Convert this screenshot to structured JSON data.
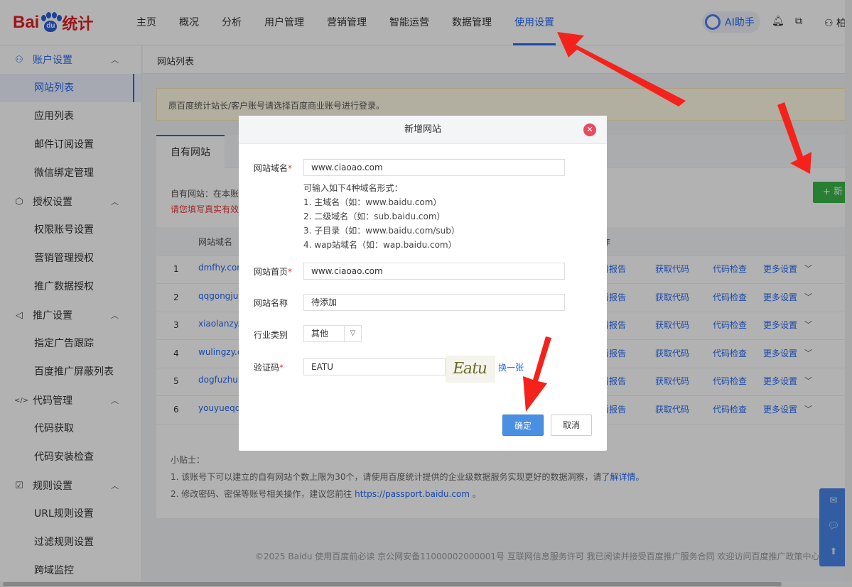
{
  "header": {
    "logo_bai": "Bai",
    "logo_du": "du",
    "logo_tongji": "统计",
    "nav": [
      "主页",
      "概况",
      "分析",
      "用户管理",
      "营销管理",
      "智能运营",
      "数据管理",
      "使用设置"
    ],
    "active_nav": "使用设置",
    "ai_label": "AI助手",
    "user_partial": "柏"
  },
  "sidebar": {
    "groups": [
      {
        "label": "账户设置",
        "icon": "user-icon",
        "items": [
          "网站列表",
          "应用列表",
          "邮件订阅设置",
          "微信绑定管理"
        ]
      },
      {
        "label": "授权设置",
        "icon": "cube-icon",
        "items": [
          "权限账号设置",
          "营销管理授权",
          "推广数据授权"
        ]
      },
      {
        "label": "推广设置",
        "icon": "megaphone-icon",
        "items": [
          "指定广告跟踪",
          "百度推广屏蔽列表"
        ]
      },
      {
        "label": "代码管理",
        "icon": "code-icon",
        "items": [
          "代码获取",
          "代码安装检查"
        ]
      },
      {
        "label": "规则设置",
        "icon": "rule-icon",
        "items": [
          "URL规则设置",
          "过滤规则设置",
          "跨域监控"
        ]
      }
    ],
    "active_item": "网站列表"
  },
  "main": {
    "breadcrumb": "网站列表",
    "notice": "原百度统计站长/客户账号请选择百度商业账号进行登录。",
    "tab": "自有网站",
    "desc1": "自有网站：在本账",
    "desc2": "请您填写真实有效",
    "add_button": "+ 新",
    "table": {
      "col_domain": "网站域名",
      "col_action_partial": "作",
      "rows": [
        {
          "num": "1",
          "domain": "dmfhy.com"
        },
        {
          "num": "2",
          "domain": "qqgongju.c"
        },
        {
          "num": "3",
          "domain": "xiaolanzy.c"
        },
        {
          "num": "4",
          "domain": "wulingzy.c"
        },
        {
          "num": "5",
          "domain": "dogfuzhu.c"
        },
        {
          "num": "6",
          "domain": "youyueqq.c"
        }
      ],
      "actions": {
        "report": "看报告",
        "get_code": "获取代码",
        "check_code": "代码检查",
        "more": "更多设置"
      }
    },
    "tips_title": "小贴士：",
    "tip1_a": "1. 该账号下可以建立的自有网站个数上限为30个，请使用百度统计提供的企业级数据服务实现更好的数据洞察，请",
    "tip1_link": "了解详情。",
    "tip2_a": "2. 修改密码、密保等账号相关操作，建议您前往 ",
    "tip2_link": "https://passport.baidu.com",
    "tip2_b": " 。"
  },
  "footer": "©2025 Baidu 使用百度前必读 京公网安备11000002000001号 互联网信息服务许可 我已阅读并接受百度推广服务合同 欢迎访问百度推广政策中心",
  "modal": {
    "title": "新增网站",
    "domain_label": "网站域名",
    "domain_value": "www.ciaoao.com",
    "hint_title": "可输入如下4种域名形式：",
    "hints": [
      "1. 主域名（如：www.baidu.com）",
      "2. 二级域名（如：sub.baidu.com）",
      "3. 子目录（如：www.baidu.com/sub）",
      "4. wap站域名（如：wap.baidu.com）"
    ],
    "home_label": "网站首页",
    "home_value": "www.ciaoao.com",
    "name_label": "网站名称",
    "name_value": "待添加",
    "industry_label": "行业类别",
    "industry_value": "其他",
    "captcha_label": "验证码",
    "captcha_value": "EATU",
    "captcha_image_text": "Eatu",
    "refresh_label": "换一张",
    "ok_label": "确定",
    "cancel_label": "取消"
  },
  "colors": {
    "primary": "#2468f2",
    "brand_red": "#de1f23",
    "add_green": "#3ab54a",
    "arrow_red": "#f5221b"
  }
}
